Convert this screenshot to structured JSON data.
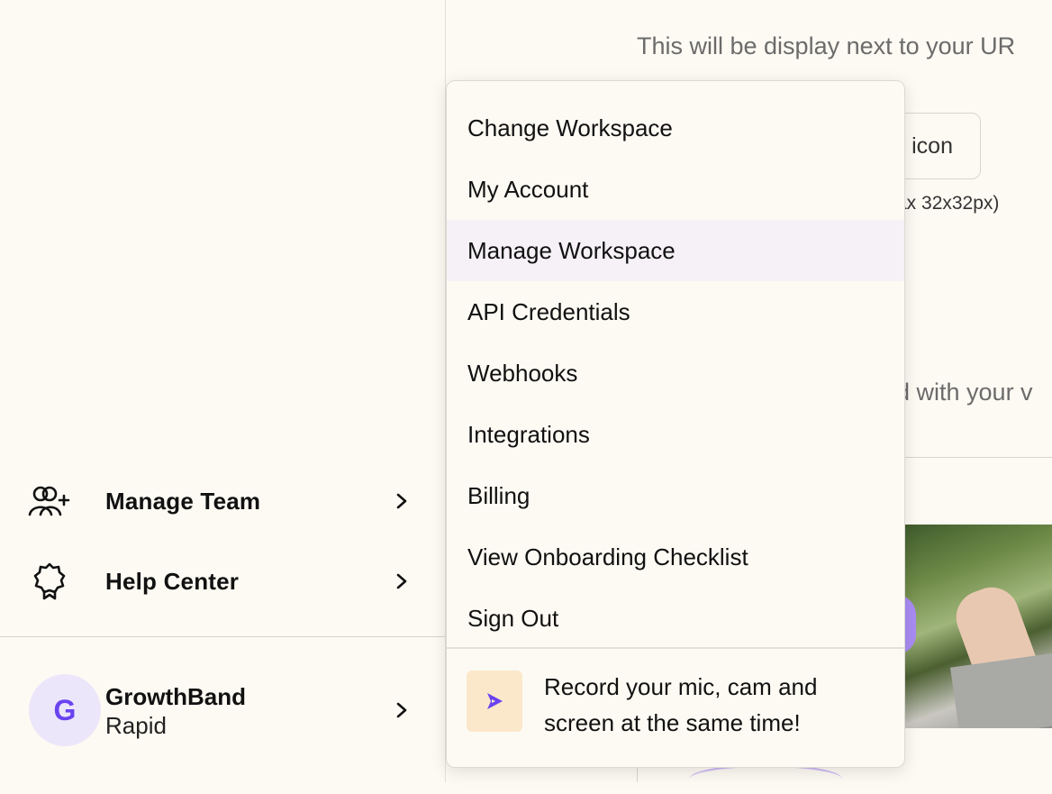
{
  "sidebar": {
    "items": [
      {
        "label": "Manage Team",
        "icon": "add-user-icon"
      },
      {
        "label": "Help Center",
        "icon": "badge-icon"
      }
    ],
    "profile": {
      "avatar_initial": "G",
      "name": "GrowthBand",
      "plan": "Rapid"
    }
  },
  "main": {
    "hint_top": "This will be display next to your UR",
    "favicon_button": "icon",
    "favicon_note": "ax 32x32px)",
    "hint_middle": "d with your v"
  },
  "dropdown": {
    "items": [
      {
        "label": "Change Workspace"
      },
      {
        "label": "My Account"
      },
      {
        "label": "Manage Workspace"
      },
      {
        "label": "API Credentials"
      },
      {
        "label": "Webhooks"
      },
      {
        "label": "Integrations"
      },
      {
        "label": "Billing"
      },
      {
        "label": "View Onboarding Checklist"
      },
      {
        "label": "Sign Out"
      }
    ],
    "active_item": "Manage Workspace",
    "promo_text": "Record your mic, cam and screen at the same time!",
    "promo_icon": "record-play-icon"
  },
  "colors": {
    "background": "#fdfaf3",
    "accent": "#6a43f0",
    "avatar_bg": "#ece6fa",
    "active_row": "#f5f1f6",
    "promo_icon_bg": "#fbe8cb"
  }
}
